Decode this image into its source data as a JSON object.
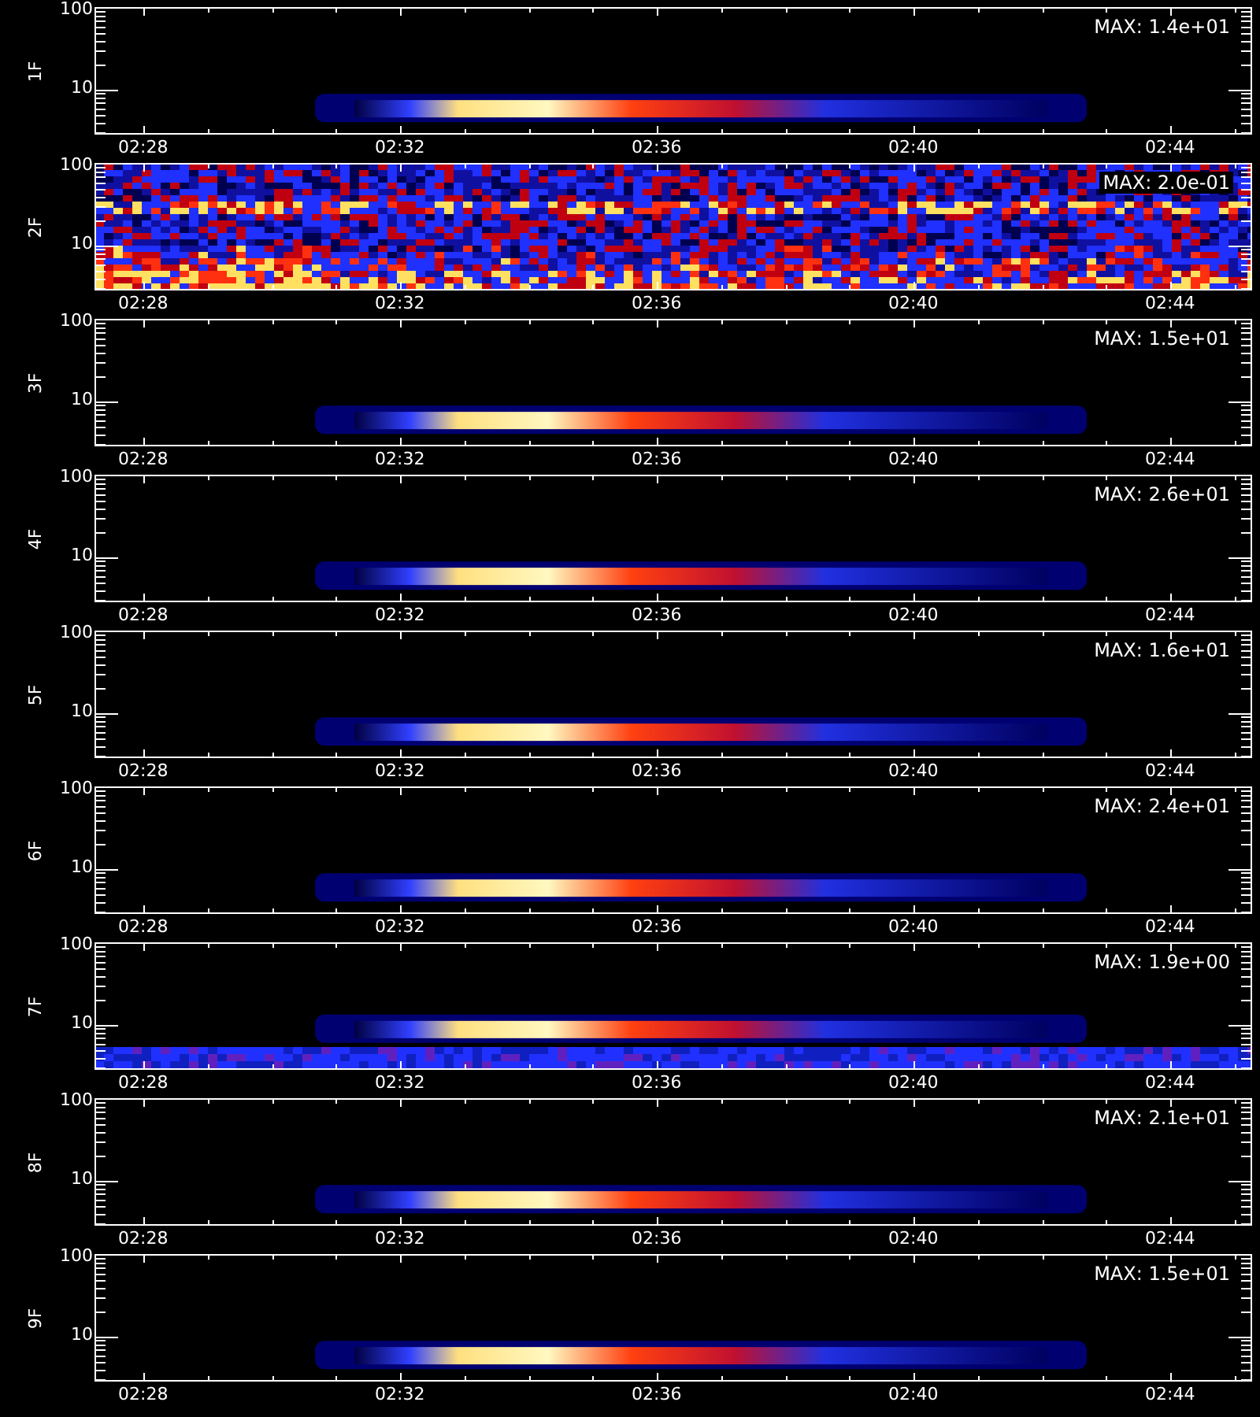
{
  "panels": [
    {
      "label": "1F",
      "kind": "burst",
      "max": "MAX: 1.4e+01",
      "y_ticks": [
        "100",
        "10"
      ],
      "x_ticks": [
        "02:28",
        "02:32",
        "02:36",
        "02:40",
        "02:44"
      ]
    },
    {
      "label": "2F",
      "kind": "noise",
      "max": "MAX: 2.0e-01",
      "y_ticks": [
        "100",
        "10"
      ],
      "x_ticks": [
        "02:28",
        "02:32",
        "02:36",
        "02:40",
        "02:44"
      ]
    },
    {
      "label": "3F",
      "kind": "burst",
      "max": "MAX: 1.5e+01",
      "y_ticks": [
        "100",
        "10"
      ],
      "x_ticks": [
        "02:28",
        "02:32",
        "02:36",
        "02:40",
        "02:44"
      ]
    },
    {
      "label": "4F",
      "kind": "burst",
      "max": "MAX: 2.6e+01",
      "y_ticks": [
        "100",
        "10"
      ],
      "x_ticks": [
        "02:28",
        "02:32",
        "02:36",
        "02:40",
        "02:44"
      ]
    },
    {
      "label": "5F",
      "kind": "burst",
      "max": "MAX: 1.6e+01",
      "y_ticks": [
        "100",
        "10"
      ],
      "x_ticks": [
        "02:28",
        "02:32",
        "02:36",
        "02:40",
        "02:44"
      ]
    },
    {
      "label": "6F",
      "kind": "burst",
      "max": "MAX: 2.4e+01",
      "y_ticks": [
        "100",
        "10"
      ],
      "x_ticks": [
        "02:28",
        "02:32",
        "02:36",
        "02:40",
        "02:44"
      ]
    },
    {
      "label": "7F",
      "kind": "burst-band",
      "max": "MAX: 1.9e+00",
      "y_ticks": [
        "100",
        "10"
      ],
      "x_ticks": [
        "02:28",
        "02:32",
        "02:36",
        "02:40",
        "02:44"
      ]
    },
    {
      "label": "8F",
      "kind": "burst",
      "max": "MAX: 2.1e+01",
      "y_ticks": [
        "100",
        "10"
      ],
      "x_ticks": [
        "02:28",
        "02:32",
        "02:36",
        "02:40",
        "02:44"
      ]
    },
    {
      "label": "9F",
      "kind": "burst",
      "max": "MAX: 1.5e+01",
      "y_ticks": [
        "100",
        "10"
      ],
      "x_ticks": [
        "02:28",
        "02:32",
        "02:36",
        "02:40",
        "02:44"
      ]
    }
  ]
}
